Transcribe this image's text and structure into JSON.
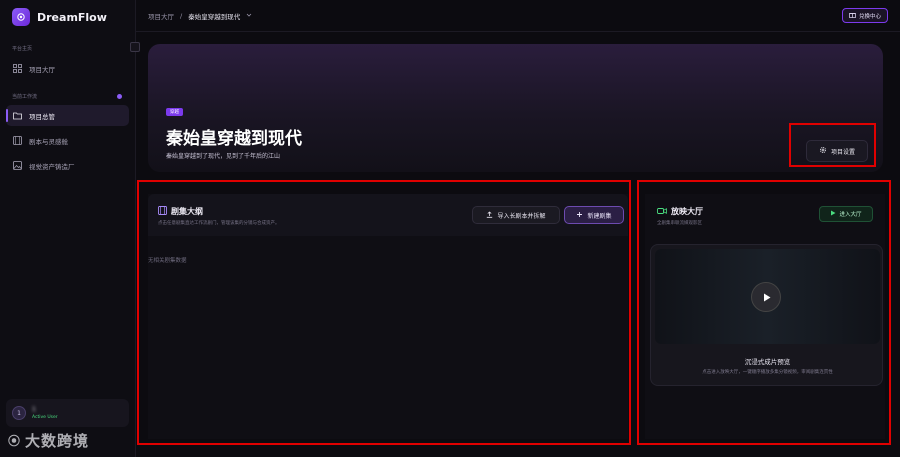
{
  "brand": {
    "name": "DreamFlow"
  },
  "sidebar": {
    "section_platform": "平台主页",
    "item_hall": "项目大厅",
    "section_current": "当前工作流",
    "items": [
      {
        "label": "项目总管",
        "active": true
      },
      {
        "label": "剧本与灵感舱"
      },
      {
        "label": "视觉资产铸造厂"
      }
    ]
  },
  "user": {
    "avatar": "1",
    "name": "1",
    "status": "Active User"
  },
  "watermark": {
    "text": "大数跨境"
  },
  "breadcrumb": {
    "root": "项目大厅",
    "separator": "/",
    "current": "秦始皇穿越到现代"
  },
  "topbar": {
    "redeem_label": "兑换中心"
  },
  "hero": {
    "tag": "穿越",
    "title": "秦始皇穿越到现代",
    "subtitle": "秦始皇穿越到了现代，见到了千年后的江山",
    "settings_label": "项目设置"
  },
  "episodes": {
    "title": "剧集大纲",
    "desc": "点击任意剧集直达工作流剧门，管理该集的分镜与合成资产。",
    "import_label": "导入长剧本并拆解",
    "new_label": "新建剧集",
    "empty": "无相关剧集数据"
  },
  "theater": {
    "title": "放映大厅",
    "desc": "全剧集串联流媒观影区",
    "enter_label": "进入大厅",
    "preview_title": "沉浸式成片预览",
    "preview_desc": "点击进入放映大厅，一键顺序播放多集分镜视频，审阅剧集连贯性"
  },
  "colors": {
    "accent": "#7c3aed",
    "highlight": "#e00000",
    "success": "#4ade80"
  }
}
